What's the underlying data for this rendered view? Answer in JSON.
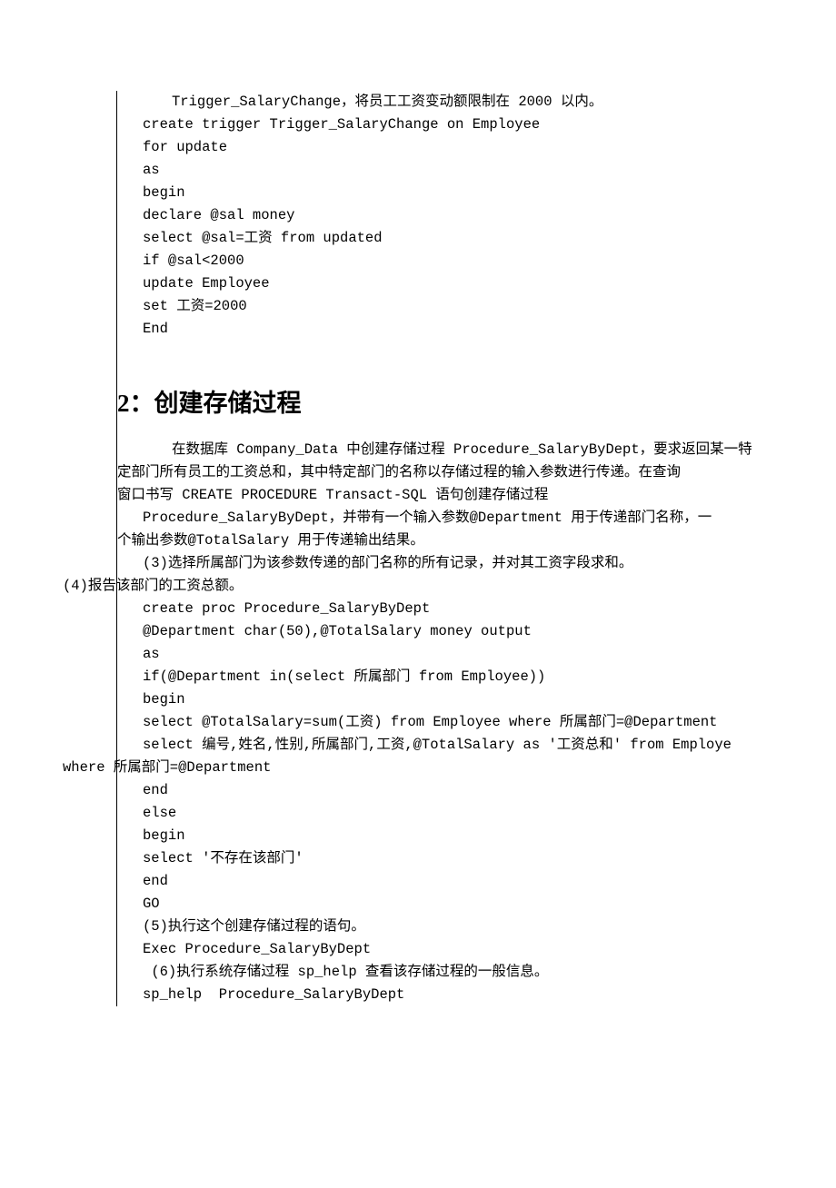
{
  "block1": {
    "l1": "Trigger_SalaryChange，将员工工资变动额限制在 2000 以内。",
    "l2": "create trigger Trigger_SalaryChange on Employee",
    "l3": "for update",
    "l4": "as",
    "l5": "begin",
    "l6": "declare @sal money",
    "l7": "select @sal=工资 from updated",
    "l8": "if @sal<2000",
    "l9": "update Employee",
    "l10": "set 工资=2000",
    "l11": "End"
  },
  "heading": "2：创建存储过程",
  "block2": {
    "l1": "在数据库 Company_Data 中创建存储过程 Procedure_SalaryByDept，要求返回某一特",
    "l2": "定部门所有员工的工资总和，其中特定部门的名称以存储过程的输入参数进行传递。在查询",
    "l3": "窗口书写 CREATE PROCEDURE Transact-SQL 语句创建存储过程",
    "l4": "Procedure_SalaryByDept，并带有一个输入参数@Department 用于传递部门名称，一",
    "l5": "个输出参数@TotalSalary 用于传递输出结果。",
    "l6": "(3)选择所属部门为该参数传递的部门名称的所有记录，并对其工资字段求和。",
    "l7": "(4)报告该部门的工资总额。",
    "l8": "create proc Procedure_SalaryByDept",
    "l9": "@Department char(50),@TotalSalary money output",
    "l10": "as",
    "l11": "if(@Department in(select 所属部门 from Employee))",
    "l12": "begin",
    "l13": "select @TotalSalary=sum(工资) from Employee where 所属部门=@Department",
    "l14": "select 编号,姓名,性别,所属部门,工资,@TotalSalary as '工资总和' from Employe",
    "l15": "where 所属部门=@Department",
    "l16": "end",
    "l17": "else",
    "l18": "begin",
    "l19": "select '不存在该部门'",
    "l20": "end",
    "l21": "GO",
    "l22": "(5)执行这个创建存储过程的语句。",
    "l23": "Exec Procedure_SalaryByDept",
    "l24": " (6)执行系统存储过程 sp_help 查看该存储过程的一般信息。",
    "l25": "sp_help  Procedure_SalaryByDept"
  }
}
